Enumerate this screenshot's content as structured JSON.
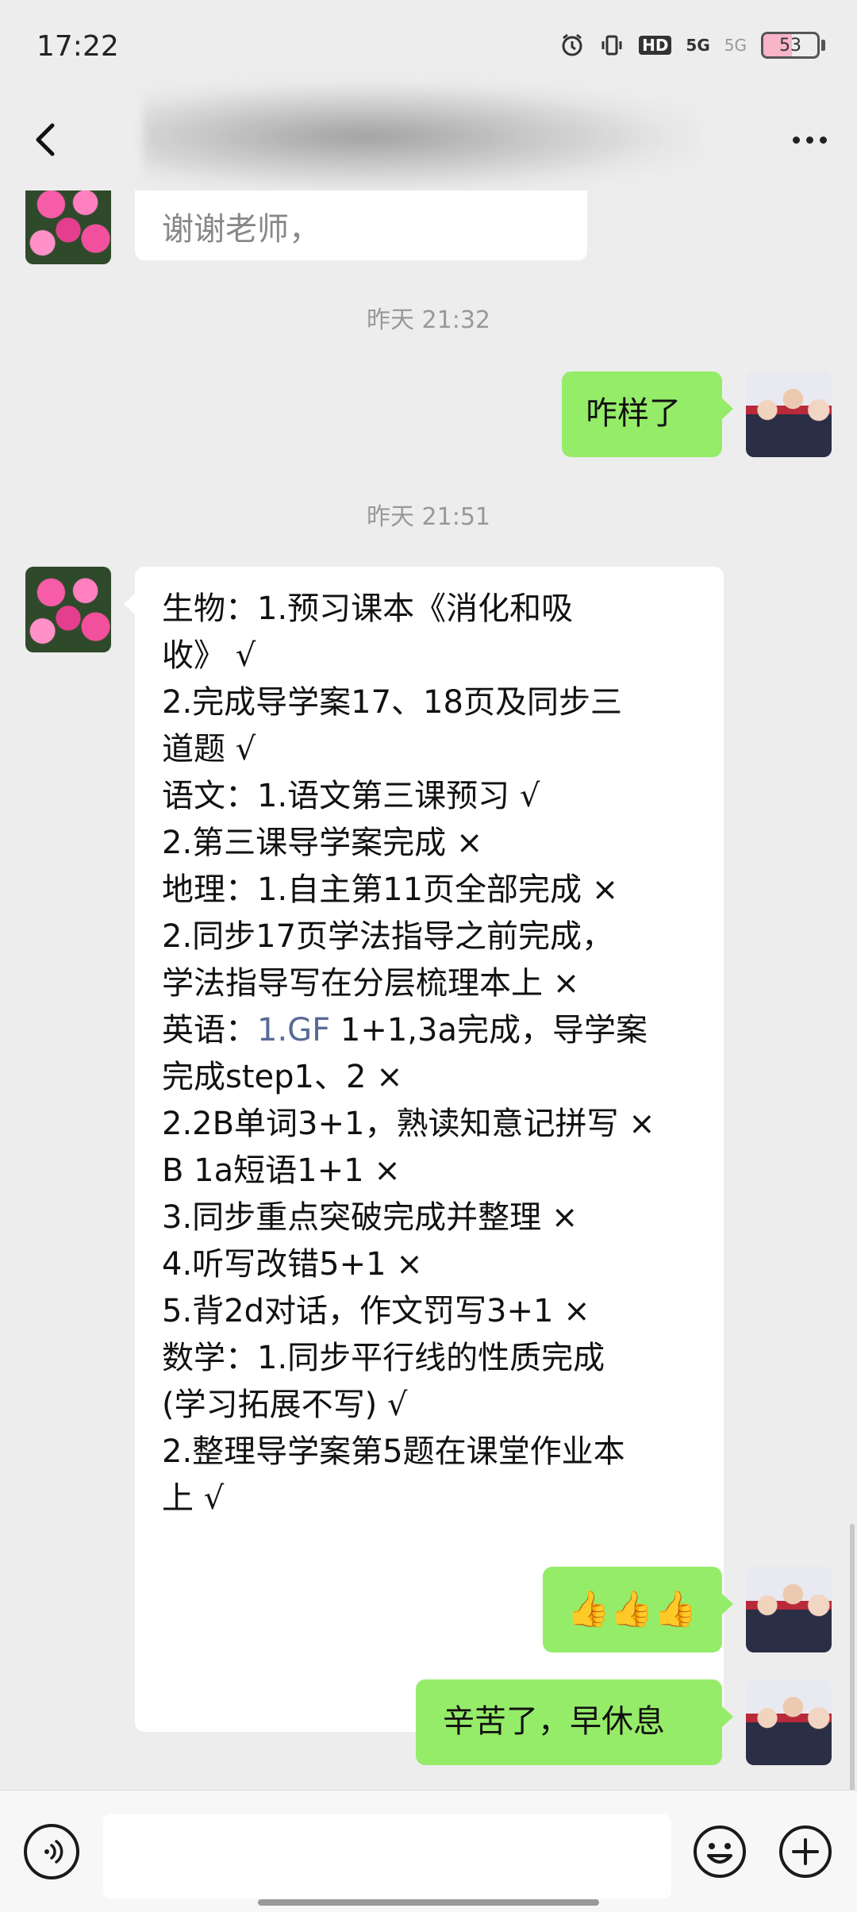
{
  "status_bar": {
    "time": "17:22",
    "signal_1": "5G",
    "signal_2": "5G",
    "hd_label": "HD",
    "battery_level": "53"
  },
  "nav": {
    "title": ""
  },
  "messages": [
    {
      "type": "incoming",
      "partial": true,
      "text": "谢谢老师，"
    },
    {
      "type": "timestamp",
      "text": "昨天 21:32"
    },
    {
      "type": "outgoing",
      "text": "咋样了"
    },
    {
      "type": "timestamp",
      "text": "昨天 21:51"
    },
    {
      "type": "incoming",
      "lines": [
        "生物：1.预习课本《消化和吸",
        "收》 √",
        "2.完成导学案17、18页及同步三",
        "道题 √",
        "语文：1.语文第三课预习 √",
        "2.第三课导学案完成 ×",
        "地理：1.自主第11页全部完成 ×",
        "2.同步17页学法指导之前完成，",
        "学法指导写在分层梳理本上 ×",
        "英语：",
        "1.GF",
        " 1+1,3a完成，导学案",
        "完成step1、2 ×",
        "2.2B单词3+1，熟读知意记拼写 ×",
        "B 1a短语1+1 ×",
        "3.同步重点突破完成并整理 ×",
        "4.听写改错5+1 ×",
        "5.背2d对话，作文罚写3+1 ×",
        "数学：1.同步平行线的性质完成",
        "(学习拓展不写) √",
        "2.整理导学案第5题在课堂作业本",
        "上 √"
      ]
    },
    {
      "type": "outgoing",
      "text": "👍👍👍"
    },
    {
      "type": "outgoing",
      "text": "辛苦了，早休息"
    }
  ],
  "input": {
    "placeholder": ""
  },
  "icons": {
    "back": "chevron-left-icon",
    "more": "more-dots-icon",
    "voice": "voice-icon",
    "emoji": "emoji-icon",
    "plus": "plus-icon"
  },
  "colors": {
    "outgoing_bubble": "#95ec69",
    "incoming_bubble": "#ffffff",
    "background": "#ededed",
    "link": "#576b95"
  }
}
